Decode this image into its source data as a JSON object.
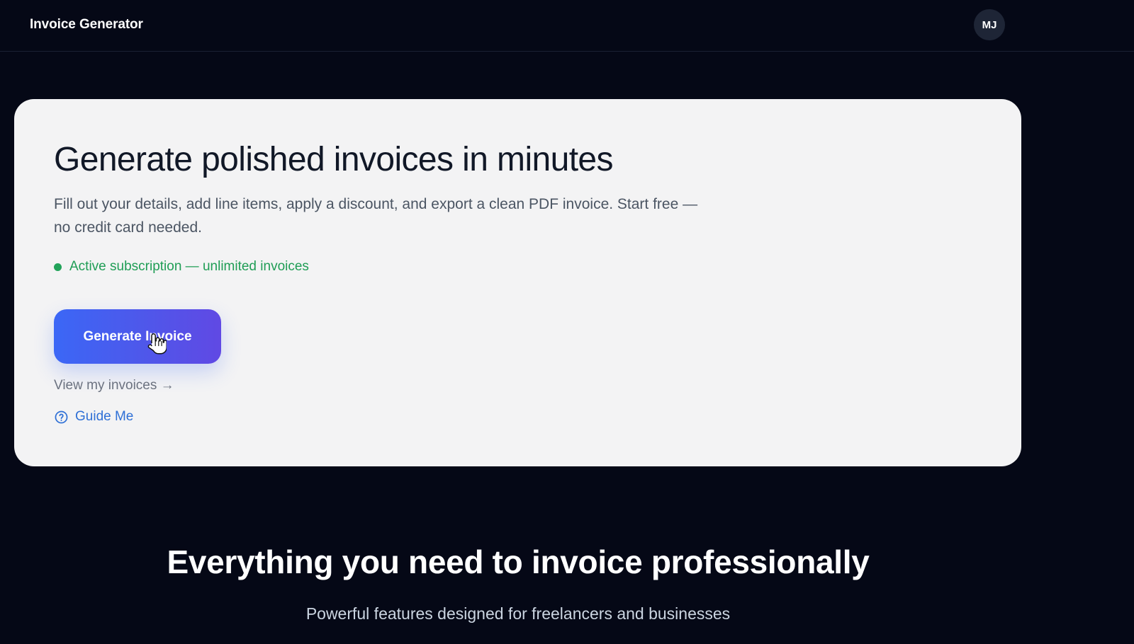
{
  "header": {
    "title": "Invoice Generator",
    "avatar_initials": "MJ"
  },
  "hero": {
    "title": "Generate polished invoices in minutes",
    "description": "Fill out your details, add line items, apply a discount, and export a clean PDF invoice. Start free — no credit card needed.",
    "status_text": "Active subscription — unlimited invoices",
    "cta_label": "Generate Invoice",
    "view_invoices_link": "View my invoices →",
    "guide_label": "Guide Me",
    "icons": {
      "status": "status-dot-icon",
      "guide": "question-circle-icon",
      "cursor": "hand-pointer-icon"
    }
  },
  "features": {
    "title": "Everything you need to invoice professionally",
    "subtitle": "Powerful features designed for freelancers and businesses"
  },
  "colors": {
    "background": "#050816",
    "card": "#f3f3f4",
    "heading": "#111827",
    "body_text": "#4b5563",
    "success": "#1f9d55",
    "link_blue": "#2f70d6",
    "button_gradient_start": "#3b67f6",
    "button_gradient_end": "#6049e4"
  }
}
